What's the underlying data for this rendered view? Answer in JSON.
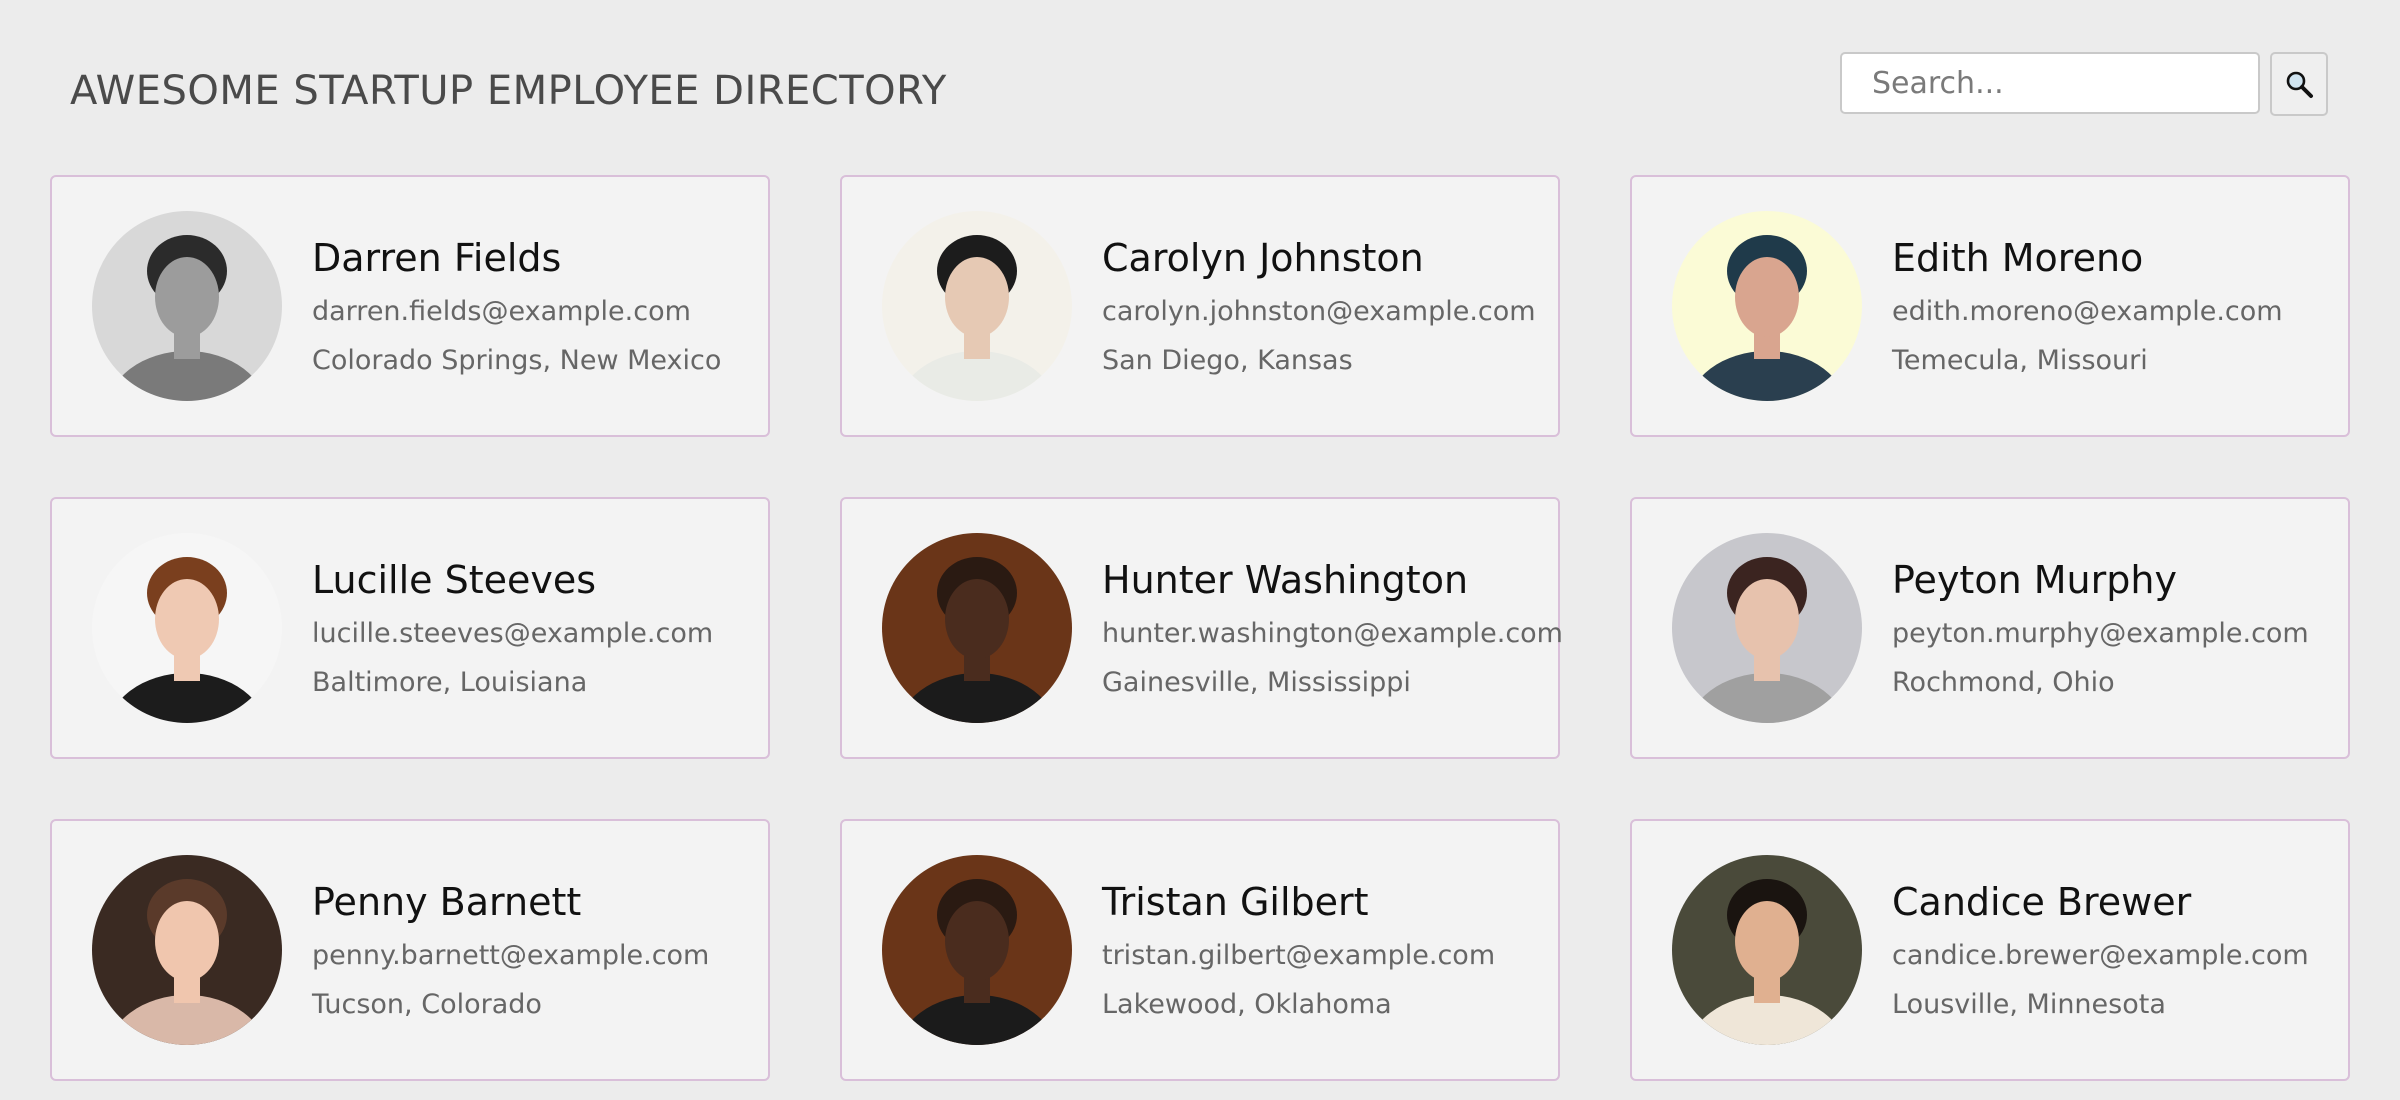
{
  "header": {
    "title": "AWESOME STARTUP EMPLOYEE DIRECTORY",
    "search_placeholder": "Search...",
    "search_icon": "magnifier-icon"
  },
  "employees": [
    {
      "name": "Darren Fields",
      "email": "darren.fields@example.com",
      "location": "Colorado Springs, New Mexico",
      "avatar": {
        "bg": "#d8d8d8",
        "skin": "#9c9c9c",
        "hair": "#2b2b2b",
        "shirt": "#7a7a7a"
      }
    },
    {
      "name": "Carolyn Johnston",
      "email": "carolyn.johnston@example.com",
      "location": "San Diego, Kansas",
      "avatar": {
        "bg": "#f3f1ea",
        "skin": "#e6c9b4",
        "hair": "#1c1c1c",
        "shirt": "#e9ebe6"
      }
    },
    {
      "name": "Edith Moreno",
      "email": "edith.moreno@example.com",
      "location": "Temecula, Missouri",
      "avatar": {
        "bg": "#fbfbd6",
        "skin": "#d9a58f",
        "hair": "#1f3a4a",
        "shirt": "#2a3f4f"
      }
    },
    {
      "name": "Lucille Steeves",
      "email": "lucille.steeves@example.com",
      "location": "Baltimore, Louisiana",
      "avatar": {
        "bg": "#f6f6f6",
        "skin": "#efc9b3",
        "hair": "#7a3f1e",
        "shirt": "#1c1c1c"
      }
    },
    {
      "name": "Hunter Washington",
      "email": "hunter.washington@example.com",
      "location": "Gainesville, Mississippi",
      "avatar": {
        "bg": "#6a3518",
        "skin": "#4a2c1e",
        "hair": "#2a1a12",
        "shirt": "#1b1b1b"
      }
    },
    {
      "name": "Peyton Murphy",
      "email": "peyton.murphy@example.com",
      "location": "Rochmond, Ohio",
      "avatar": {
        "bg": "#c7c7cc",
        "skin": "#e7c2ad",
        "hair": "#3b2420",
        "shirt": "#a0a0a0"
      }
    },
    {
      "name": "Penny Barnett",
      "email": "penny.barnett@example.com",
      "location": "Tucson, Colorado",
      "avatar": {
        "bg": "#3a2a22",
        "skin": "#f0c6ae",
        "hair": "#5a3a2a",
        "shirt": "#d9b8a8"
      }
    },
    {
      "name": "Tristan Gilbert",
      "email": "tristan.gilbert@example.com",
      "location": "Lakewood, Oklahoma",
      "avatar": {
        "bg": "#6a3518",
        "skin": "#4a2c1e",
        "hair": "#2a1a12",
        "shirt": "#1b1b1b"
      }
    },
    {
      "name": "Candice Brewer",
      "email": "candice.brewer@example.com",
      "location": "Lousville, Minnesota",
      "avatar": {
        "bg": "#4a4a3a",
        "skin": "#e0b090",
        "hair": "#1a1410",
        "shirt": "#efe6d8"
      }
    }
  ]
}
